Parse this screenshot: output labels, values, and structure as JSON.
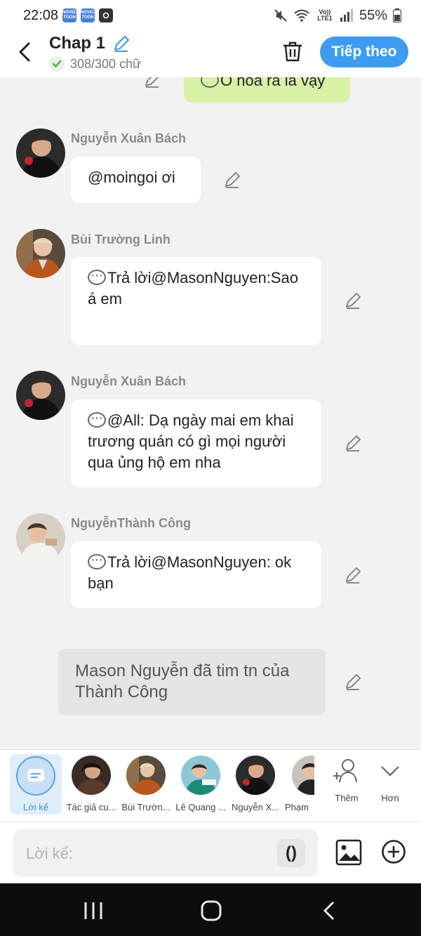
{
  "status_bar": {
    "time": "22:08",
    "app_icon_label": "NOVEL TOON",
    "network_label": "Vo)) LTE1",
    "battery": "55%"
  },
  "header": {
    "title": "Chap 1",
    "word_count": "308/300 chữ",
    "next_label": "Tiếp theo"
  },
  "chat": {
    "top_partial_message": "Ồ hóa ra là vậy",
    "messages": [
      {
        "sender": "Nguyễn Xuân Bách",
        "text": "@moingoi ơi"
      },
      {
        "sender": "Bùi Trường Linh",
        "text": "Trả lời@MasonNguyen:Sao á em"
      },
      {
        "sender": "Nguyễn Xuân Bách",
        "text": "@All: Dạ ngày mai em khai trương quán có gì mọi người qua ủng hộ em nha"
      },
      {
        "sender": "NguyễnThành Công",
        "text": "Trả lời@MasonNguyen: ok bạn"
      }
    ],
    "system_message": "Mason Nguyễn đã tim tn của Thành Công"
  },
  "characters": {
    "items": [
      {
        "label": "Lời kể"
      },
      {
        "label": "Tác giả cu..."
      },
      {
        "label": "Bùi Trườn..."
      },
      {
        "label": "Lê Quang ..."
      },
      {
        "label": "Nguyễn X..."
      },
      {
        "label": "Phạm"
      }
    ],
    "more_label": "Thêm",
    "collapse_label": "Hơn"
  },
  "composer": {
    "placeholder": "Lời kể:",
    "paren_label": "()"
  },
  "colors": {
    "accent": "#3d9cf0",
    "green_bubble": "#d8f2a6",
    "background": "#f2f2f2"
  }
}
